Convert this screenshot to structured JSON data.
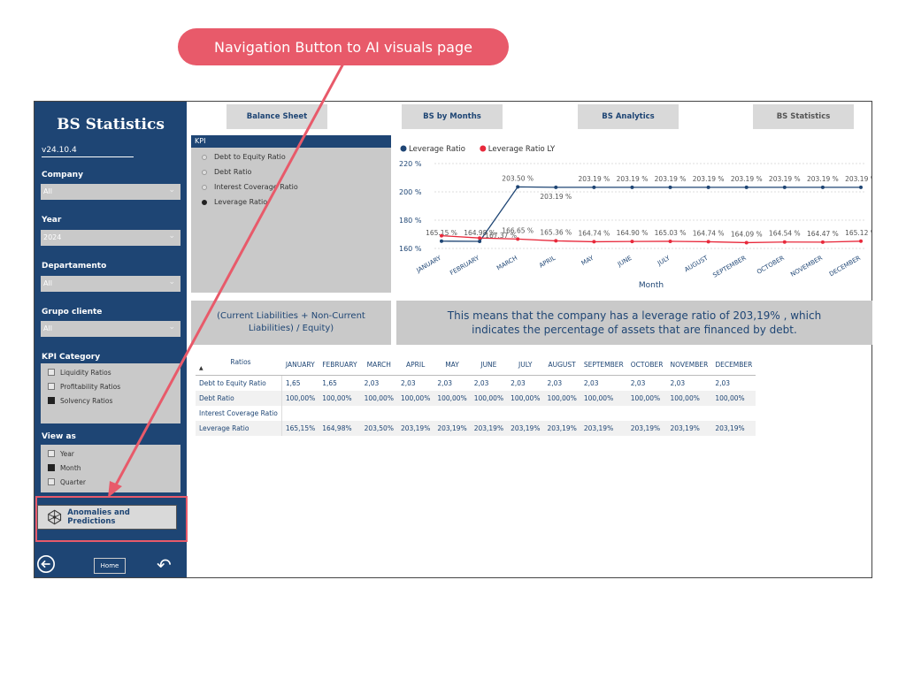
{
  "callout": {
    "text": "Navigation Button to AI visuals page"
  },
  "sidebar": {
    "title": "BS Statistics",
    "version": "v24.10.4",
    "filters": [
      {
        "label": "Company",
        "value": "All"
      },
      {
        "label": "Year",
        "value": "2024"
      },
      {
        "label": "Departamento",
        "value": "All"
      },
      {
        "label": "Grupo cliente",
        "value": "All"
      }
    ],
    "kpi_category": {
      "label": "KPI Category",
      "items": [
        {
          "label": "Liquidity Ratios",
          "checked": false
        },
        {
          "label": "Profitability Ratios",
          "checked": false
        },
        {
          "label": "Solvency Ratios",
          "checked": true
        }
      ]
    },
    "view_as": {
      "label": "View as",
      "items": [
        {
          "label": "Year",
          "checked": false
        },
        {
          "label": "Month",
          "checked": true
        },
        {
          "label": "Quarter",
          "checked": false
        }
      ]
    },
    "anomalies_button": "Anomalies and Predictions",
    "home_button": "Home"
  },
  "nav": [
    {
      "label": "Balance Sheet",
      "active": true
    },
    {
      "label": "BS by Months",
      "active": true
    },
    {
      "label": "BS Analytics",
      "active": true
    },
    {
      "label": "BS Statistics",
      "active": false
    }
  ],
  "kpi": {
    "header": "KPI",
    "items": [
      {
        "label": "Debt to Equity Ratio",
        "selected": false
      },
      {
        "label": "Debt Ratio",
        "selected": false
      },
      {
        "label": "Interest Coverage Ratio",
        "selected": false
      },
      {
        "label": "Leverage Ratio",
        "selected": true
      }
    ]
  },
  "formula": "(Current Liabilities + Non-Current Liabilities) / Equity)",
  "means": "This means that the company has a leverage ratio of 203,19%  , which indicates the percentage of assets that are financed by debt.",
  "chart_data": {
    "type": "line",
    "xlabel": "Month",
    "ylabel": "",
    "categories": [
      "JANUARY",
      "FEBRUARY",
      "MARCH",
      "APRIL",
      "MAY",
      "JUNE",
      "JULY",
      "AUGUST",
      "SEPTEMBER",
      "OCTOBER",
      "NOVEMBER",
      "DECEMBER"
    ],
    "yticks": [
      "220 %",
      "200 %",
      "180 %",
      "160 %"
    ],
    "ylim": [
      160,
      220
    ],
    "series": [
      {
        "name": "Leverage Ratio",
        "color": "#1e4574",
        "values": [
          165.15,
          164.98,
          203.5,
          203.19,
          203.19,
          203.19,
          203.19,
          203.19,
          203.19,
          203.19,
          203.19,
          203.19
        ],
        "labels": [
          "165.15 %",
          "164.98 %",
          "203.50 %",
          "203.19 %",
          "203.19 %",
          "203.19 %",
          "203.19 %",
          "203.19 %",
          "203.19 %",
          "203.19 %",
          "203.19 %",
          "203.19 %"
        ]
      },
      {
        "name": "Leverage Ratio LY",
        "color": "#e8293b",
        "values": [
          169.0,
          167.37,
          166.65,
          165.36,
          164.74,
          164.9,
          165.03,
          164.74,
          164.09,
          164.54,
          164.47,
          165.12
        ],
        "labels": [
          "",
          "167.37 %",
          "166.65 %",
          "165.36 %",
          "164.74 %",
          "164.90 %",
          "165.03 %",
          "164.74 %",
          "164.09 %",
          "164.54 %",
          "164.47 %",
          "165.12 %"
        ]
      }
    ],
    "legend": "top-left",
    "grid": true
  },
  "table": {
    "headers": [
      "Ratios",
      "JANUARY",
      "FEBRUARY",
      "MARCH",
      "APRIL",
      "MAY",
      "JUNE",
      "JULY",
      "AUGUST",
      "SEPTEMBER",
      "OCTOBER",
      "NOVEMBER",
      "DECEMBER"
    ],
    "rows": [
      [
        "Debt to Equity Ratio",
        "1,65",
        "1,65",
        "2,03",
        "2,03",
        "2,03",
        "2,03",
        "2,03",
        "2,03",
        "2,03",
        "2,03",
        "2,03",
        "2,03"
      ],
      [
        "Debt Ratio",
        "100,00%",
        "100,00%",
        "100,00%",
        "100,00%",
        "100,00%",
        "100,00%",
        "100,00%",
        "100,00%",
        "100,00%",
        "100,00%",
        "100,00%",
        "100,00%"
      ],
      [
        "Interest Coverage Ratio",
        "",
        "",
        "",
        "",
        "",
        "",
        "",
        "",
        "",
        "",
        "",
        ""
      ],
      [
        "Leverage Ratio",
        "165,15%",
        "164,98%",
        "203,50%",
        "203,19%",
        "203,19%",
        "203,19%",
        "203,19%",
        "203,19%",
        "203,19%",
        "203,19%",
        "203,19%",
        "203,19%"
      ]
    ]
  }
}
